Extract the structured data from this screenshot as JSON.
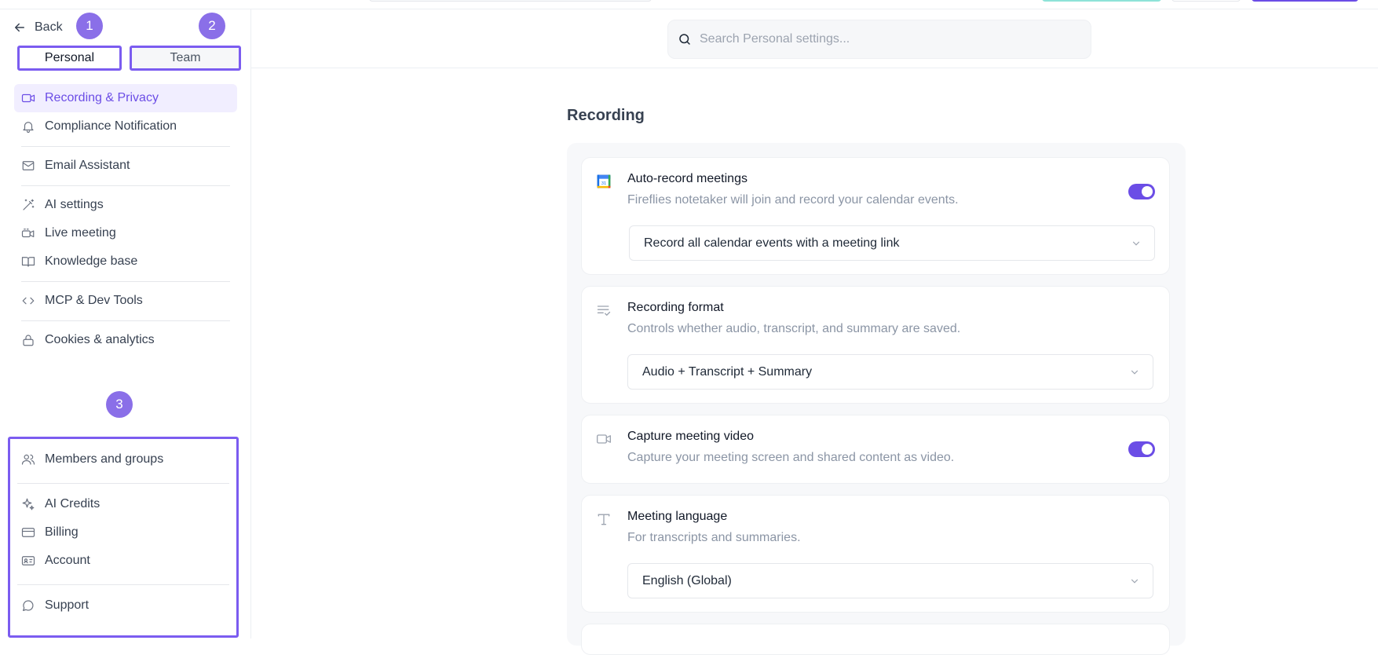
{
  "sidebar": {
    "back_label": "Back",
    "badges": [
      "1",
      "2",
      "3"
    ],
    "tabs": {
      "personal": "Personal",
      "team": "Team"
    },
    "personal_items": {
      "recording_privacy": "Recording & Privacy",
      "compliance": "Compliance Notification",
      "email_assistant": "Email Assistant",
      "ai_settings": "AI settings",
      "live_meeting": "Live meeting",
      "knowledge_base": "Knowledge base",
      "mcp_dev_tools": "MCP & Dev Tools",
      "cookies": "Cookies & analytics"
    },
    "team_items": {
      "members": "Members and groups",
      "ai_credits": "AI Credits",
      "billing": "Billing",
      "account": "Account",
      "support": "Support"
    },
    "accent_color": "#6b4de6"
  },
  "search": {
    "placeholder": "Search Personal settings..."
  },
  "main": {
    "section_title": "Recording",
    "cards": {
      "auto_record": {
        "title": "Auto-record meetings",
        "desc": "Fireflies notetaker will join and record your calendar events.",
        "select_value": "Record all calendar events with a meeting link",
        "toggle_on": true,
        "icon": "calendar-icon",
        "calendar_day": "31"
      },
      "recording_format": {
        "title": "Recording format",
        "desc": "Controls whether audio, transcript, and summary are saved.",
        "select_value": "Audio + Transcript + Summary",
        "icon": "list-check-icon"
      },
      "capture_video": {
        "title": "Capture meeting video",
        "desc": "Capture your meeting screen and shared content as video.",
        "toggle_on": true,
        "icon": "video-icon"
      },
      "meeting_language": {
        "title": "Meeting language",
        "desc": "For transcripts and summaries.",
        "select_value": "English (Global)",
        "icon": "text-icon"
      }
    }
  }
}
